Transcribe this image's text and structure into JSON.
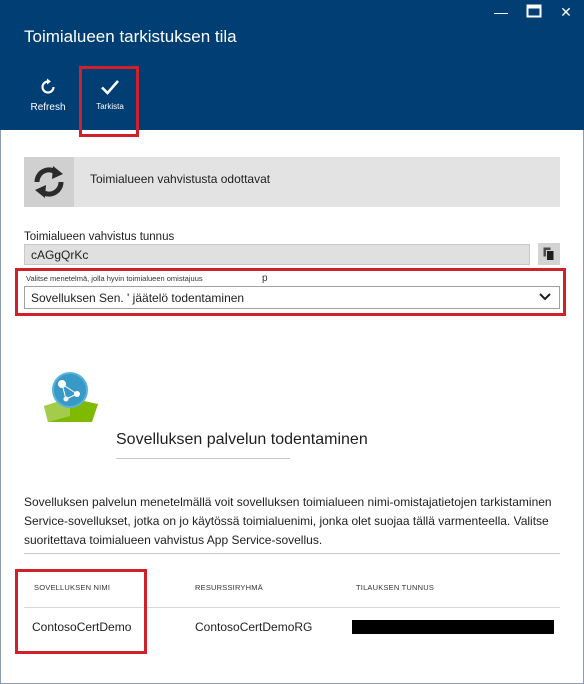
{
  "window": {
    "title": "Toimialueen tarkistuksen tila",
    "minimize_glyph": "—",
    "maximize_glyph": "☐",
    "close_glyph": "✕"
  },
  "toolbar": {
    "refresh_label": "Refresh",
    "verify_label": "Tarkista"
  },
  "status": {
    "text": "Toimialueen vahvistusta odottavat"
  },
  "verification": {
    "label": "Toimialueen vahvistus tunnus",
    "value": "cAGgQrKc"
  },
  "method": {
    "label": "Valitse menetelmä, jolla hyvin toimialueen omistajuus",
    "label_suffix": "p",
    "selected": "Sovelluksen Sen. ' jäätelö todentaminen"
  },
  "service": {
    "title": "Sovelluksen palvelun todentaminen",
    "description": "Sovelluksen palvelun menetelmällä voit sovelluksen toimialueen nimi-omistajatietojen tarkistaminen Service-sovellukset, jotka on jo käytössä toimialuenimi, jonka olet suojaa tällä varmenteella. Valitse suoritettava toimialueen vahvistus App Service-sovellus."
  },
  "table": {
    "headers": [
      "SOVELLUKSEN NIMI",
      "RESURSSIRYHMÄ",
      "TILAUKSEN TUNNUS"
    ],
    "rows": [
      {
        "app_name": "ContosoCertDemo",
        "resource_group": "ContosoCertDemoRG",
        "subscription_id": ""
      }
    ]
  },
  "colors": {
    "header_bg": "#003e73",
    "highlight": "#d0202a",
    "banner_bg": "#e3e3e3"
  }
}
